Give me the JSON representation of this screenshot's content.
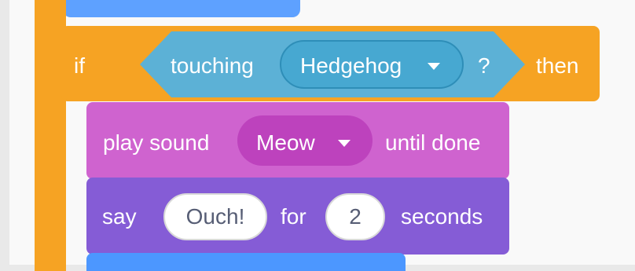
{
  "if_block": {
    "if_label": "if",
    "then_label": "then"
  },
  "condition": {
    "label": "touching",
    "sprite": "Hedgehog",
    "suffix": "?"
  },
  "sound_block": {
    "label": "play sound",
    "sound": "Meow",
    "suffix": "until done"
  },
  "say_block": {
    "label": "say",
    "message": "Ouch!",
    "for_label": "for",
    "seconds": "2",
    "suffix": "seconds"
  },
  "colors": {
    "control": "#f6a323",
    "sensing": "#5cb1d6",
    "sound": "#cf63cf",
    "looks": "#855cd6",
    "motion": "#4c97ff"
  },
  "icons": {
    "dropdown": "caret-down-icon"
  }
}
